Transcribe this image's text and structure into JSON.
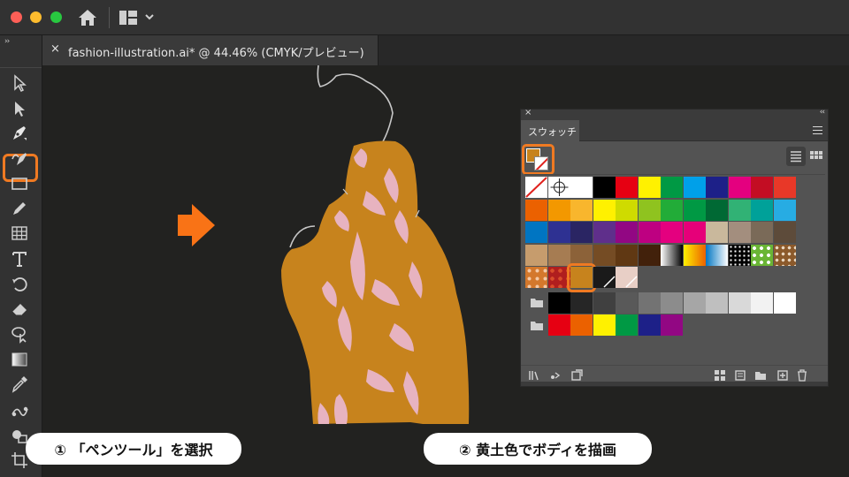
{
  "window": {
    "buttons": [
      "close",
      "minimize",
      "zoom"
    ],
    "icons": [
      "home-icon",
      "workspace-layout-icon",
      "chevron-down-icon"
    ]
  },
  "document_tab": {
    "close_label": "×",
    "title": "fashion-illustration.ai* @ 44.46% (CMYK/プレビュー)"
  },
  "toolbar": {
    "grip": "››",
    "tools": [
      "selection",
      "direct-selection",
      "pen",
      "curvature",
      "rectangle",
      "pencil",
      "table-grid",
      "type",
      "rotate",
      "eraser",
      "lasso-select",
      "gradient",
      "eyedropper",
      "blend",
      "shape-builder",
      "crop"
    ],
    "selected_tool": "pen"
  },
  "swatches_panel": {
    "close_label": "×",
    "collapse_label": "‹‹",
    "tab_label": "スウォッチ",
    "fill_color": "#c7831d",
    "stroke": "none",
    "view_modes": [
      "list",
      "grid"
    ],
    "active_view": "grid",
    "rows": [
      [
        "none",
        "registration",
        "#ffffff",
        "#000000",
        "#e60012",
        "#fff100",
        "#009944",
        "#00a0e9",
        "#1d2088",
        "#e4007f",
        "#c30d23",
        "#e83828"
      ],
      [
        "#eb6100",
        "#f39800",
        "#f8b62d",
        "#fff100",
        "#cfdb00",
        "#8fc31f",
        "#22ac38",
        "#009944",
        "#006934",
        "#31b275",
        "#00a199",
        "#27ace3"
      ],
      [
        "#0075c2",
        "#2e3192",
        "#2a2563",
        "#5f2f8b",
        "#920783",
        "#be0081",
        "#e4007f",
        "#e60079",
        "#c9b89c",
        "#a38e7e",
        "#7a6a58",
        "#5d4b3a"
      ],
      [
        "#c69c6d",
        "#a67c52",
        "#8c6239",
        "#754c24",
        "#603813",
        "#42210b",
        "gradient-bw",
        "gradient-orange",
        "gradient-blue",
        "pattern-dots",
        "pattern-green",
        "pattern-brown"
      ],
      [
        "pattern-floral-orange",
        "pattern-red",
        "#c7831d",
        "#1a1a1a",
        "#e8cfc6"
      ],
      [
        "folder",
        "#000000",
        "#262626",
        "#404040",
        "#595959",
        "#737373",
        "#8c8c8c",
        "#a6a6a6",
        "#bfbfbf",
        "#d9d9d9",
        "#f2f2f2",
        "#ffffff"
      ],
      [
        "folder",
        "#e60012",
        "#eb6100",
        "#fff100",
        "#009944",
        "#1d2088",
        "#920783"
      ]
    ],
    "selected_swatch": "#c7831d",
    "bottom_icons": [
      "library-icon",
      "swatch-kind-icon",
      "swatch-options-icon",
      "color-group-icon",
      "new-color-group-icon",
      "folder-icon",
      "new-swatch-icon",
      "trash-icon"
    ]
  },
  "artwork": {
    "body_color": "#c7831d",
    "pattern_color": "#e7b3c0",
    "canvas_color": "#222220"
  },
  "annotations": {
    "arrow_color": "#f97316",
    "step1": "① 「ペンツール」を選択",
    "step2": "② 黄土色でボディを描画"
  }
}
